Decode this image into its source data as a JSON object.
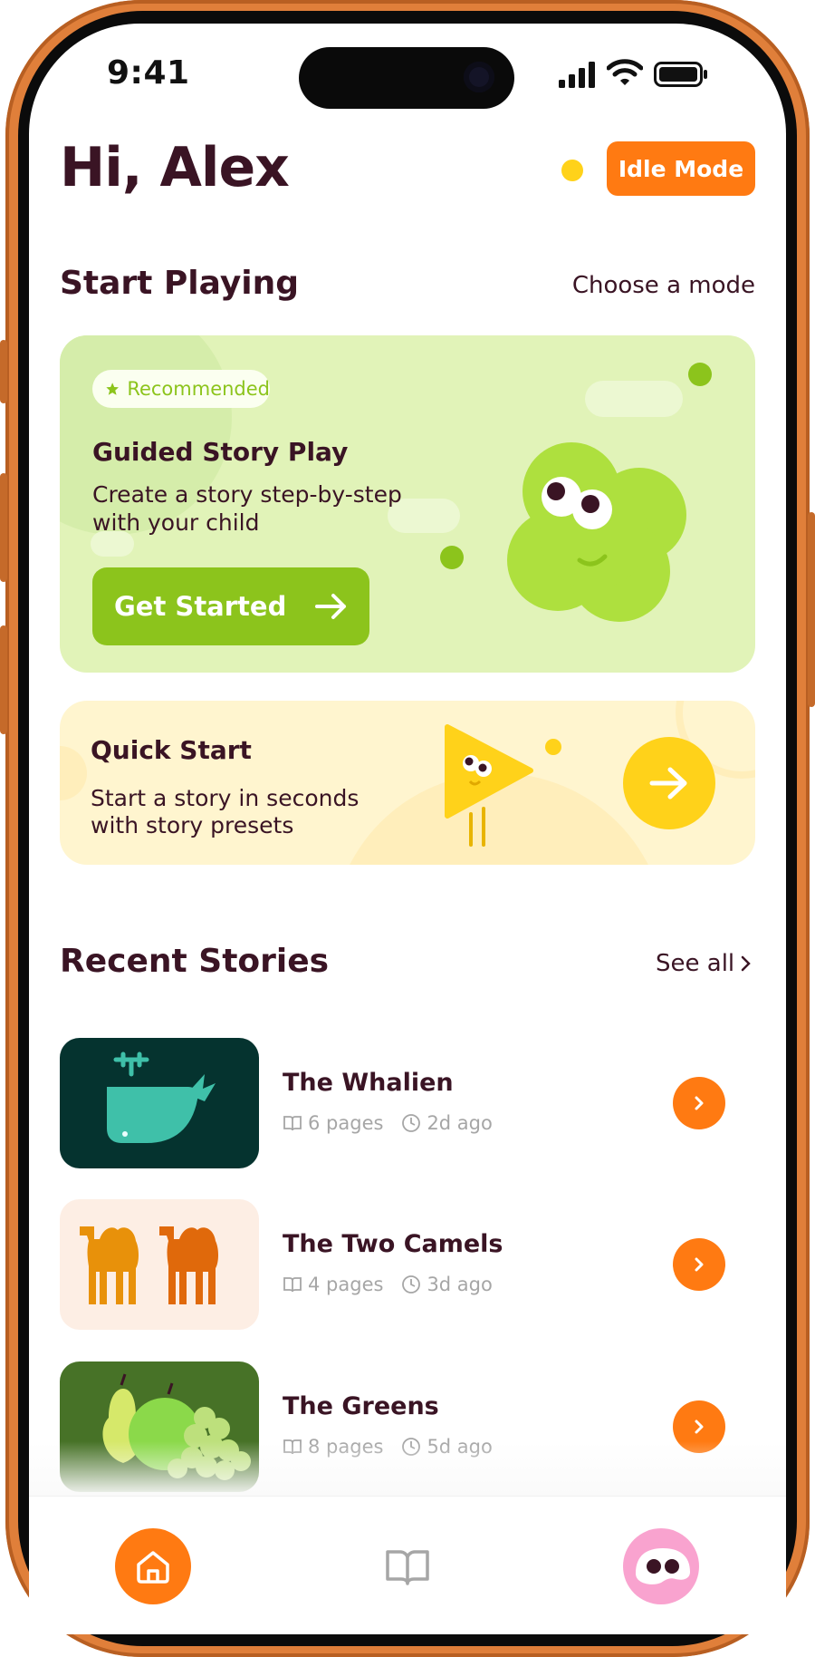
{
  "status_bar": {
    "time": "9:41"
  },
  "header": {
    "greeting": "Hi, Alex",
    "idle_mode_label": "Idle Mode"
  },
  "start_playing": {
    "title": "Start Playing",
    "link": "Choose a mode",
    "guided": {
      "badge": "Recommended",
      "title": "Guided Story Play",
      "desc_line1": "Create a story step-by-step",
      "desc_line2": "with your child",
      "button": "Get Started"
    },
    "quick": {
      "title": "Quick Start",
      "desc_line1": "Start a story in seconds",
      "desc_line2": "with story presets"
    }
  },
  "recent": {
    "title": "Recent Stories",
    "link": "See all",
    "stories": [
      {
        "title": "The Whalien",
        "pages": "6 pages",
        "ago": "2d ago",
        "thumb_color": "#05332f"
      },
      {
        "title": "The Two Camels",
        "pages": "4 pages",
        "ago": "3d ago",
        "thumb_color": "#fdeee4"
      },
      {
        "title": "The Greens",
        "pages": "8 pages",
        "ago": "5d ago",
        "thumb_color": "#477227"
      }
    ]
  },
  "colors": {
    "accent": "#ff7a12",
    "green": "#8cc41c",
    "yellow": "#ffd21a",
    "text": "#3a1424"
  },
  "tabbar": {
    "items": [
      "home-icon",
      "book-icon",
      "profile-icon"
    ]
  }
}
